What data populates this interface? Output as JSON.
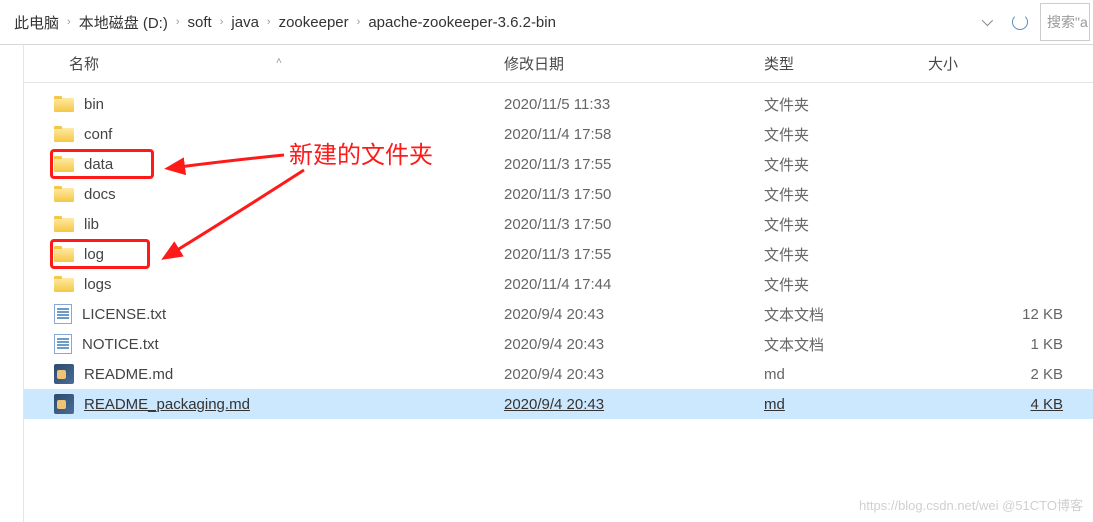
{
  "breadcrumb": [
    "此电脑",
    "本地磁盘 (D:)",
    "soft",
    "java",
    "zookeeper",
    "apache-zookeeper-3.6.2-bin"
  ],
  "search_placeholder": "搜索\"a",
  "columns": {
    "name": "名称",
    "modified": "修改日期",
    "type": "类型",
    "size": "大小"
  },
  "files": [
    {
      "name": "bin",
      "modified": "2020/11/5 11:33",
      "type": "文件夹",
      "size": "",
      "icon": "folder",
      "highlighted": false,
      "selected": false
    },
    {
      "name": "conf",
      "modified": "2020/11/4 17:58",
      "type": "文件夹",
      "size": "",
      "icon": "folder",
      "highlighted": false,
      "selected": false
    },
    {
      "name": "data",
      "modified": "2020/11/3 17:55",
      "type": "文件夹",
      "size": "",
      "icon": "folder",
      "highlighted": true,
      "selected": false
    },
    {
      "name": "docs",
      "modified": "2020/11/3 17:50",
      "type": "文件夹",
      "size": "",
      "icon": "folder",
      "highlighted": false,
      "selected": false
    },
    {
      "name": "lib",
      "modified": "2020/11/3 17:50",
      "type": "文件夹",
      "size": "",
      "icon": "folder",
      "highlighted": false,
      "selected": false
    },
    {
      "name": "log",
      "modified": "2020/11/3 17:55",
      "type": "文件夹",
      "size": "",
      "icon": "folder",
      "highlighted": true,
      "selected": false
    },
    {
      "name": "logs",
      "modified": "2020/11/4 17:44",
      "type": "文件夹",
      "size": "",
      "icon": "folder",
      "highlighted": false,
      "selected": false
    },
    {
      "name": "LICENSE.txt",
      "modified": "2020/9/4 20:43",
      "type": "文本文档",
      "size": "12 KB",
      "icon": "txt",
      "highlighted": false,
      "selected": false
    },
    {
      "name": "NOTICE.txt",
      "modified": "2020/9/4 20:43",
      "type": "文本文档",
      "size": "1 KB",
      "icon": "txt",
      "highlighted": false,
      "selected": false
    },
    {
      "name": "README.md",
      "modified": "2020/9/4 20:43",
      "type": "md",
      "size": "2 KB",
      "icon": "md",
      "highlighted": false,
      "selected": false
    },
    {
      "name": "README_packaging.md",
      "modified": "2020/9/4 20:43",
      "type": "md",
      "size": "4 KB",
      "icon": "md",
      "highlighted": false,
      "selected": true
    }
  ],
  "annotation_label": "新建的文件夹",
  "annotation_color": "#ff1a1a",
  "watermark": "https://blog.csdn.net/wei    @51CTO博客"
}
